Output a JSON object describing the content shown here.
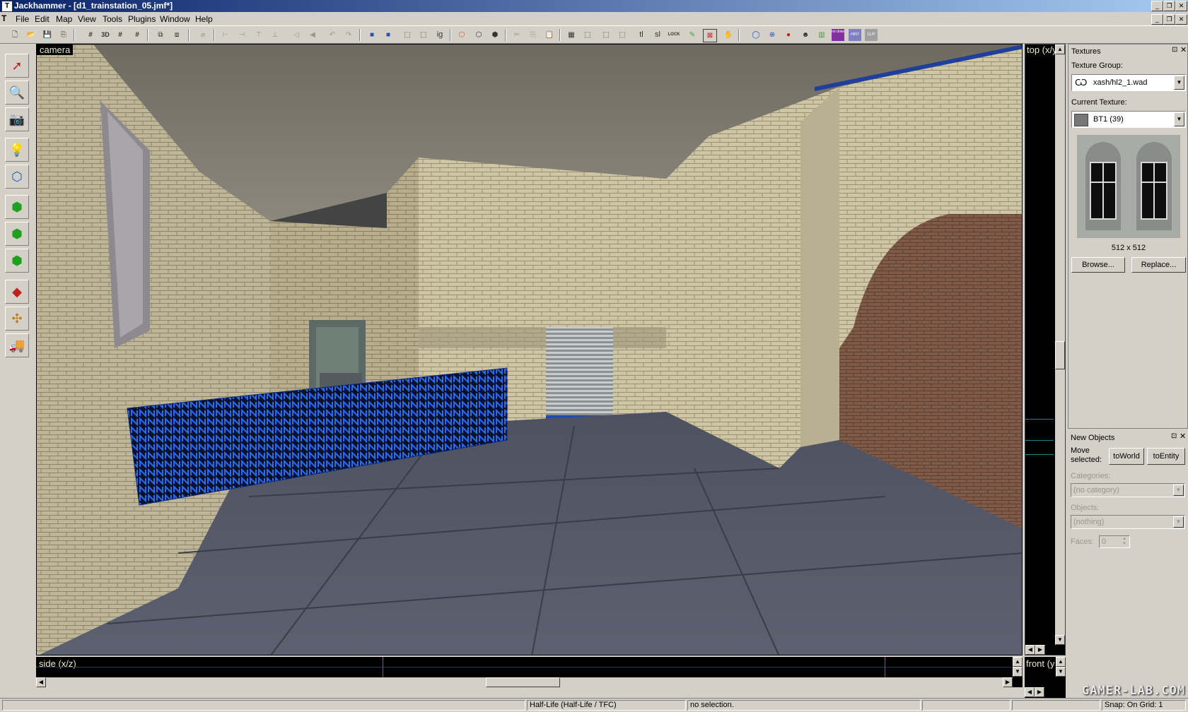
{
  "window": {
    "title": "Jackhammer - [d1_trainstation_05.jmf*]",
    "app_icon": "jackhammer-icon",
    "controls": [
      "minimize-icon",
      "maximize-icon",
      "close-icon"
    ]
  },
  "menubar": {
    "items": [
      "File",
      "Edit",
      "Map",
      "View",
      "Tools",
      "Plugins",
      "Window",
      "Help"
    ]
  },
  "toolbar": {
    "text_buttons": {
      "tl": "tl",
      "sl": "sl",
      "ig": "ig",
      "lock": "LOCK",
      "nodraw": "no draw",
      "hint": "HINT",
      "clip": "CLIP"
    }
  },
  "leftbar": {
    "tools": [
      "selection-tool-icon",
      "magnify-tool-icon",
      "camera-tool-icon",
      "entity-tool-icon",
      "block-tool-icon",
      "texture-application-icon",
      "apply-texture-icon",
      "decal-tool-icon",
      "overlay-tool-icon",
      "path-tool-icon",
      "vertex-tool-icon",
      "vehicle-tool-icon"
    ]
  },
  "viewports": {
    "camera_label": "camera",
    "top_label": "top (x/y)",
    "side_label": "side (x/z)",
    "front_label": "front (y/z)"
  },
  "textures_panel": {
    "title": "Textures",
    "group_label": "Texture Group:",
    "group_value": "xash/hl2_1.wad",
    "current_label": "Current Texture:",
    "current_value": "BT1 (39)",
    "size": "512 x 512",
    "browse": "Browse...",
    "replace": "Replace..."
  },
  "new_objects_panel": {
    "title": "New Objects",
    "move_label_1": "Move",
    "move_label_2": "selected:",
    "to_world": "toWorld",
    "to_entity": "toEntity",
    "categories_label": "Categories:",
    "categories_value": "(no category)",
    "objects_label": "Objects:",
    "objects_value": "(nothing)",
    "faces_label": "Faces:",
    "faces_value": "0"
  },
  "statusbar": {
    "game": "Half-Life (Half-Life / TFC)",
    "selection": "no selection.",
    "snap": "Snap: On Grid: 1"
  },
  "watermark": "GAMER-LAB.COM",
  "colors": {
    "titlebar": "#0a246a",
    "panel": "#d4d0c8",
    "selection_blue": "#1a4fd8"
  }
}
